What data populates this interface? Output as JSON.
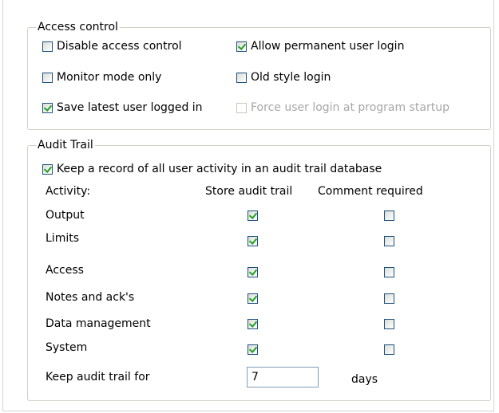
{
  "access_control": {
    "legend": "Access control",
    "options": [
      {
        "label": "Disable access control",
        "checked": false,
        "enabled": true
      },
      {
        "label": "Allow permanent user login",
        "checked": true,
        "enabled": true
      },
      {
        "label": "Monitor mode only",
        "checked": false,
        "enabled": true
      },
      {
        "label": "Old style login",
        "checked": false,
        "enabled": true
      },
      {
        "label": "Save latest user logged in",
        "checked": true,
        "enabled": true
      },
      {
        "label": "Force user login at program startup",
        "checked": false,
        "enabled": false
      }
    ]
  },
  "audit_trail": {
    "legend": "Audit Trail",
    "keep_record": {
      "label": "Keep a record of all user activity in an audit trail database",
      "checked": true
    },
    "headers": {
      "activity": "Activity:",
      "store": "Store audit trail",
      "comment": "Comment required"
    },
    "rows": [
      {
        "activity": "Output",
        "store": true,
        "comment": false
      },
      {
        "activity": "Limits",
        "store": true,
        "comment": false
      },
      {
        "activity": "Access",
        "store": true,
        "comment": false
      },
      {
        "activity": "Notes and ack's",
        "store": true,
        "comment": false
      },
      {
        "activity": "Data management",
        "store": true,
        "comment": false
      },
      {
        "activity": "System",
        "store": true,
        "comment": false
      }
    ],
    "keep_for_label": "Keep audit trail for",
    "keep_for_value": "7",
    "keep_for_unit": "days"
  },
  "colors": {
    "group_border": "#d4d0c8",
    "checkbox_border": "#1c5180",
    "check_mark": "#21a121",
    "disabled_text": "#a7a6aa"
  }
}
